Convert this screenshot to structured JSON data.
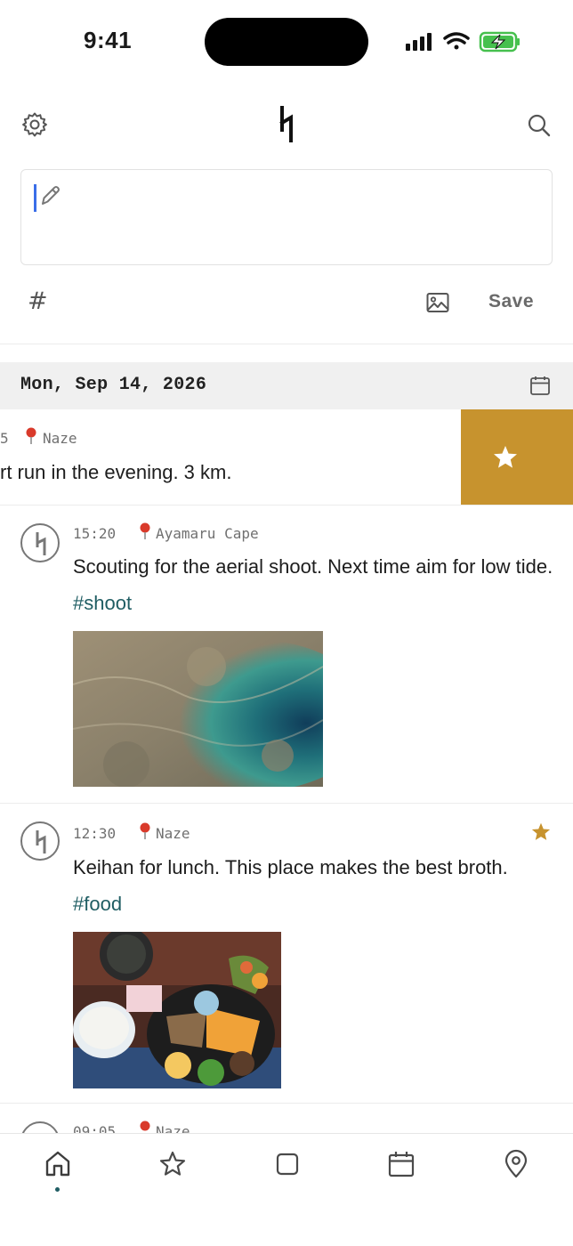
{
  "status_bar": {
    "time": "9:41"
  },
  "header": {
    "settings_icon": "gear-icon",
    "logo_glyph": "ᛋ",
    "search_icon": "search-icon"
  },
  "composer": {
    "placeholder_icon": "pencil-icon",
    "hashtag_label": "#",
    "image_icon": "image-icon",
    "save_label": "Save"
  },
  "date_header": {
    "date": "Mon, Sep 14, 2026",
    "calendar_icon": "calendar-icon"
  },
  "entries": [
    {
      "time": "5",
      "location": "Naze",
      "text": "rt run in the evening. 3 km.",
      "swiped": true,
      "action": "star-icon",
      "action_color": "#c7932e"
    },
    {
      "time": "15:20",
      "location": "Ayamaru Cape",
      "text": "Scouting for the aerial shoot. Next time aim for low tide.",
      "tag": "#shoot",
      "image": "aerial-reef-photo",
      "starred": false
    },
    {
      "time": "12:30",
      "location": "Naze",
      "text": "Keihan for lunch. This place makes the best broth.",
      "tag": "#food",
      "image": "keihan-meal-photo",
      "starred": true,
      "star_color": "#c7932e"
    },
    {
      "time": "09:05",
      "location": "Naze"
    }
  ],
  "tab_bar": {
    "tabs": [
      "home-icon",
      "star-icon",
      "square-icon",
      "calendar-icon",
      "map-pin-icon"
    ],
    "active": 0,
    "accent": "#1f5d63"
  }
}
